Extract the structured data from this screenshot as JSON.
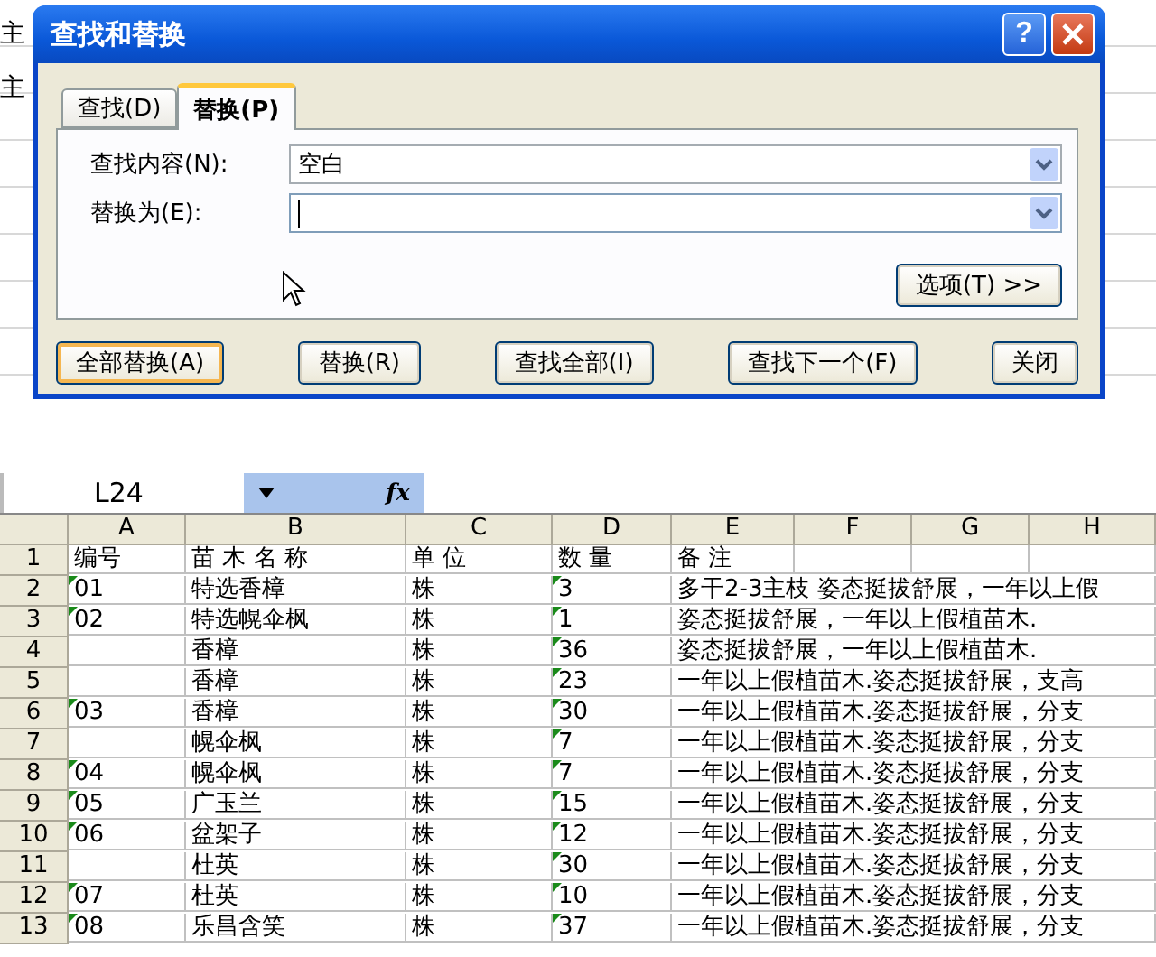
{
  "background_cells": [
    "主",
    "主"
  ],
  "dialog": {
    "title": "查找和替换",
    "help": "?",
    "tabs": [
      {
        "label": "查找(D)",
        "selected": false
      },
      {
        "label": "替换(P)",
        "selected": true
      }
    ],
    "fields": [
      {
        "label": "查找内容(N):",
        "value": "空白",
        "focused": false
      },
      {
        "label": "替换为(E):",
        "focused": true
      }
    ],
    "options_button": "选项(T) >>",
    "buttons": [
      {
        "label": "全部替换(A)",
        "default": true
      },
      {
        "label": "替换(R)",
        "default": false
      },
      {
        "label": "查找全部(I)",
        "default": false
      },
      {
        "label": "查找下一个(F)",
        "default": false
      },
      {
        "label": "关闭",
        "default": false
      }
    ]
  },
  "sheet": {
    "name_box": "L24",
    "function_symbol": "fx",
    "columns": [
      "A",
      "B",
      "C",
      "D",
      "E",
      "F",
      "G",
      "H"
    ],
    "rows": [
      {
        "number": "1",
        "cells": [
          "编号",
          "苗 木 名 称",
          "单 位",
          "数 量",
          "备  注"
        ]
      },
      {
        "number": "2",
        "cells": [
          "01",
          "特选香樟",
          "株",
          "3",
          "多干2-3主枝 姿态挺拔舒展，一年以上假"
        ]
      },
      {
        "number": "3",
        "cells": [
          "02",
          "特选幌伞枫",
          "株",
          "1",
          "姿态挺拔舒展，一年以上假植苗木."
        ]
      },
      {
        "number": "4",
        "cells": [
          "",
          "香樟",
          "株",
          "36",
          "姿态挺拔舒展，一年以上假植苗木."
        ]
      },
      {
        "number": "5",
        "cells": [
          "",
          "香樟",
          "株",
          "23",
          "一年以上假植苗木.姿态挺拔舒展，支高"
        ]
      },
      {
        "number": "6",
        "cells": [
          "03",
          "香樟",
          "株",
          "30",
          "一年以上假植苗木.姿态挺拔舒展，分支"
        ]
      },
      {
        "number": "7",
        "cells": [
          "",
          "幌伞枫",
          "株",
          "7",
          "一年以上假植苗木.姿态挺拔舒展，分支"
        ]
      },
      {
        "number": "8",
        "cells": [
          "04",
          "幌伞枫",
          "株",
          "7",
          "一年以上假植苗木.姿态挺拔舒展，分支"
        ]
      },
      {
        "number": "9",
        "cells": [
          "05",
          "广玉兰",
          "株",
          "15",
          "一年以上假植苗木.姿态挺拔舒展，分支"
        ]
      },
      {
        "number": "10",
        "cells": [
          "06",
          "盆架子",
          "株",
          "12",
          "一年以上假植苗木.姿态挺拔舒展，分支"
        ]
      },
      {
        "number": "11",
        "cells": [
          "",
          "杜英",
          "株",
          "30",
          "一年以上假植苗木.姿态挺拔舒展，分支"
        ]
      },
      {
        "number": "12",
        "cells": [
          "07",
          "杜英",
          "株",
          "10",
          "一年以上假植苗木.姿态挺拔舒展，分支"
        ]
      },
      {
        "number": "13",
        "cells": [
          "08",
          "乐昌含笑",
          "株",
          "37",
          "一年以上假植苗木.姿态挺拔舒展，分支"
        ]
      }
    ]
  }
}
